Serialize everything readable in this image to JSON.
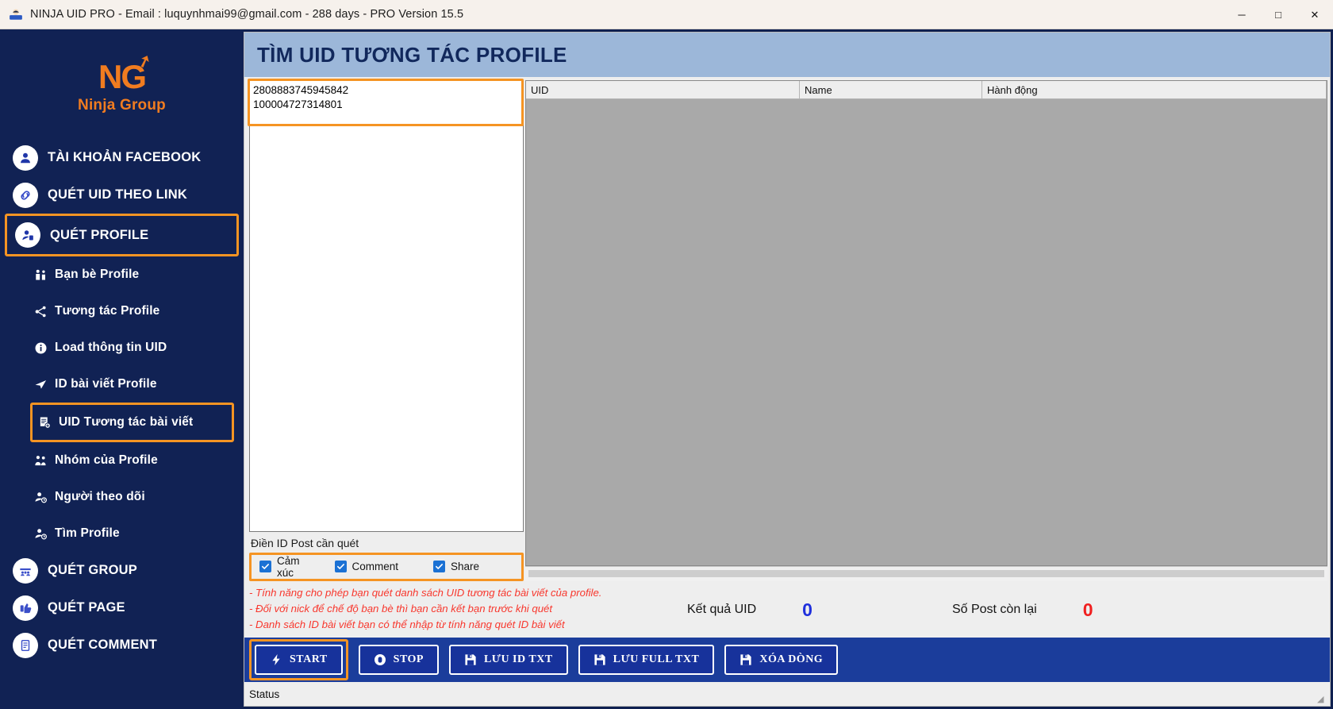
{
  "titlebar": {
    "icon": "app-icon",
    "title": "NINJA UID PRO - Email : luquynhmai99@gmail.com - 288 days -  PRO Version 15.5",
    "minimize": "─",
    "maximize": "□",
    "close": "✕"
  },
  "sidebar": {
    "logo": {
      "mark": "NG",
      "text": "Ninja Group",
      "color": "#f07c20"
    },
    "items": [
      {
        "label": "TÀI KHOẢN FACEBOOK",
        "icon": "user-circle-icon",
        "type": "main",
        "selected": false
      },
      {
        "label": "QUÉT UID THEO LINK",
        "icon": "link-icon",
        "type": "main",
        "selected": false
      },
      {
        "label": "QUÉT PROFILE",
        "icon": "user-scan-icon",
        "type": "main",
        "selected": true
      },
      {
        "label": "Bạn bè Profile",
        "icon": "friends-icon",
        "type": "sub",
        "selected": false
      },
      {
        "label": "Tương tác Profile",
        "icon": "share-nodes-icon",
        "type": "sub",
        "selected": false
      },
      {
        "label": "Load thông tin UID",
        "icon": "info-icon",
        "type": "sub",
        "selected": false
      },
      {
        "label": "ID bài viết Profile",
        "icon": "send-icon",
        "type": "sub",
        "selected": false
      },
      {
        "label": "UID Tương tác bài viết",
        "icon": "document-add-icon",
        "type": "sub",
        "selected": true
      },
      {
        "label": "Nhóm của Profile",
        "icon": "group-icon",
        "type": "sub",
        "selected": false
      },
      {
        "label": "Người theo dõi",
        "icon": "user-follow-icon",
        "type": "sub",
        "selected": false
      },
      {
        "label": "Tìm Profile",
        "icon": "user-search-icon",
        "type": "sub",
        "selected": false
      },
      {
        "label": "QUÉT GROUP",
        "icon": "group-circle-icon",
        "type": "main",
        "selected": false
      },
      {
        "label": "QUÉT PAGE",
        "icon": "page-icon",
        "type": "main",
        "selected": false
      },
      {
        "label": "QUÉT COMMENT",
        "icon": "comment-doc-icon",
        "type": "main",
        "selected": false
      }
    ]
  },
  "main": {
    "header_title": "TÌM UID TƯƠNG TÁC PROFILE",
    "id_input": {
      "value": "2808883745945842\n100004727314801",
      "placeholder": ""
    },
    "id_input_label": "Điền ID Post cần quét",
    "checkboxes": [
      {
        "label": "Cảm xúc",
        "checked": true
      },
      {
        "label": "Comment",
        "checked": true
      },
      {
        "label": "Share",
        "checked": true
      }
    ],
    "grid": {
      "columns": [
        "UID",
        "Name",
        "Hành động"
      ],
      "rows": []
    },
    "notes": [
      "- Tính năng cho phép bạn quét danh sách UID tương tác bài viết của profile.",
      "- Đối với nick để chế độ bạn bè thì bạn cần kết bạn trước khi quét",
      "- Danh sách ID bài viết bạn có thể nhập từ tính năng quét ID bài viết"
    ],
    "results": [
      {
        "label": "Kết quả UID",
        "value": "0",
        "color": "#1f2fdc"
      },
      {
        "label": "Số Post còn lại",
        "value": "0",
        "color": "#f02020"
      }
    ],
    "buttons": [
      {
        "label": "START",
        "icon": "bolt-icon",
        "selected": true
      },
      {
        "label": "STOP",
        "icon": "stop-icon",
        "selected": false
      },
      {
        "label": "LƯU ID TXT",
        "icon": "save-icon",
        "selected": false
      },
      {
        "label": "LƯU FULL TXT",
        "icon": "save-icon",
        "selected": false
      },
      {
        "label": "XÓA DÒNG",
        "icon": "save-icon",
        "selected": false
      }
    ],
    "status": "Status"
  },
  "colors": {
    "sidebar_bg": "#112254",
    "accent_orange": "#f59423",
    "header_blue": "#9cb7d9",
    "button_blue": "#17329b"
  }
}
